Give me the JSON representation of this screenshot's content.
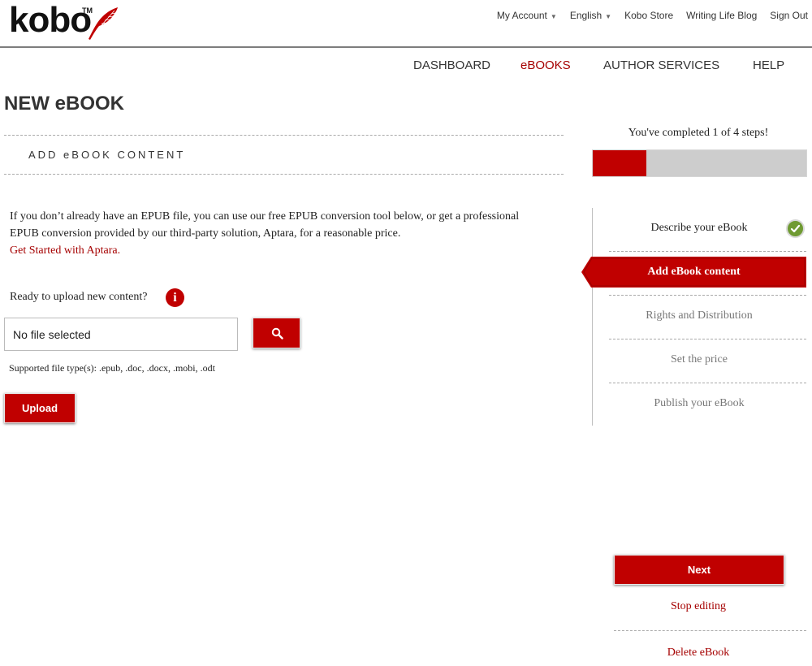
{
  "brand": {
    "logo_text": "kobo",
    "tm": "TM",
    "accent_color": "#c00000"
  },
  "top_links": {
    "my_account": "My Account",
    "language": "English",
    "kobo_store": "Kobo Store",
    "writing_life_blog": "Writing Life Blog",
    "sign_out": "Sign Out"
  },
  "main_nav": {
    "dashboard": "DASHBOARD",
    "ebooks": "eBOOKS",
    "author_services": "AUTHOR SERVICES",
    "help": "HELP"
  },
  "page": {
    "title": "NEW eBOOK",
    "section_title": "ADD eBOOK CONTENT"
  },
  "content": {
    "intro_text": "If you don’t already have an EPUB file, you can use our free EPUB conversion tool below, or get a professional EPUB conversion provided by our third-party solution, Aptara, for a reasonable price.",
    "aptara_link": "Get Started with Aptara.",
    "ready_label": "Ready to upload new content?",
    "info_icon": "i",
    "file_field_value": "No file selected",
    "supported_types": "Supported file type(s): .epub, .doc, .docx, .mobi, .odt",
    "upload_label": "Upload"
  },
  "progress": {
    "text": "You've completed 1 of 4 steps!",
    "completed": 1,
    "total": 4
  },
  "steps": [
    {
      "label": "Describe your eBook",
      "state": "done"
    },
    {
      "label": "Add eBook content",
      "state": "active"
    },
    {
      "label": "Rights and Distribution",
      "state": "todo"
    },
    {
      "label": "Set the price",
      "state": "todo"
    },
    {
      "label": "Publish your eBook",
      "state": "todo"
    }
  ],
  "actions": {
    "next_label": "Next",
    "stop_editing": "Stop editing",
    "delete_ebook": "Delete eBook"
  }
}
